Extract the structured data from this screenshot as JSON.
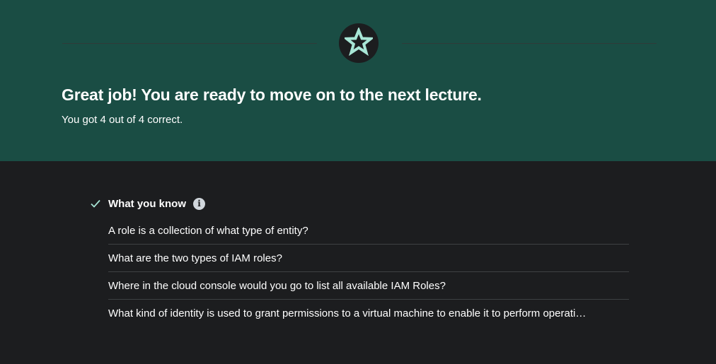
{
  "banner": {
    "headline": "Great job! You are ready to move on to the next lecture.",
    "score_text": "You got 4 out of 4 correct.",
    "badge_icon": "star-icon",
    "background_color": "#1a4d44",
    "accent_color": "#a8e6d6"
  },
  "results": {
    "section_title": "What you know",
    "section_icon": "check-icon",
    "info_icon": "info-icon",
    "info_glyph": "i",
    "questions": [
      "A role is a collection of what type of entity?",
      "What are the two types of IAM roles?",
      "Where in the cloud console would you go to list all available IAM Roles?",
      "What kind of identity is used to grant permissions to a virtual machine to enable it to perform operati…"
    ]
  }
}
